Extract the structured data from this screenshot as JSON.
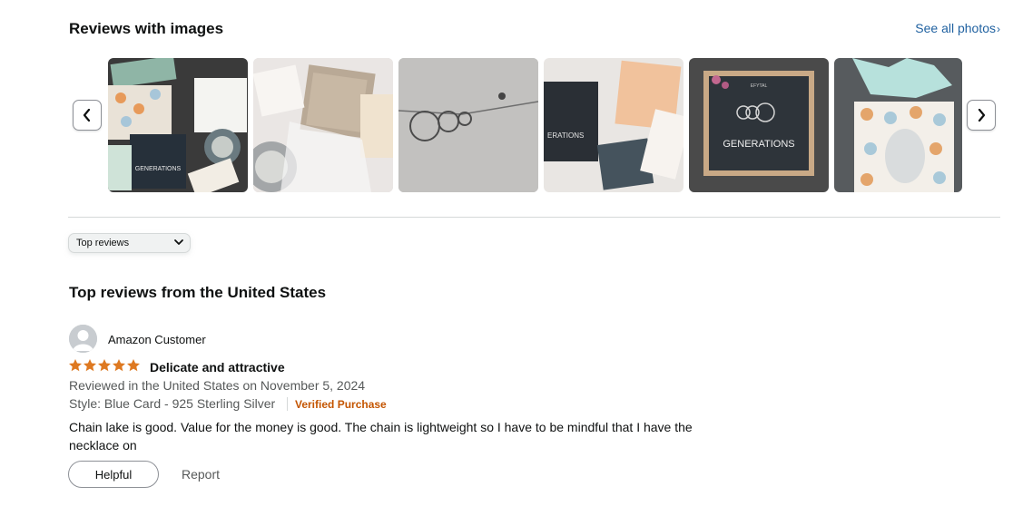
{
  "images_section": {
    "title": "Reviews with images",
    "see_all_label": "See all photos",
    "thumbnails": [
      {
        "name": "photo-1-gift-set",
        "overlay_text": "GENERATIONS"
      },
      {
        "name": "photo-2-packaging",
        "overlay_text": ""
      },
      {
        "name": "photo-3-necklace-closeup",
        "overlay_text": ""
      },
      {
        "name": "photo-4-card",
        "overlay_text": "ERATIONS"
      },
      {
        "name": "photo-5-card-display",
        "overlay_text": "GENERATIONS",
        "brand_text": "EFYTAL"
      },
      {
        "name": "photo-6-gift-bag",
        "overlay_text": ""
      }
    ],
    "icons": {
      "prev": "chevron-left-icon",
      "next": "chevron-right-icon"
    }
  },
  "sort": {
    "selected": "Top reviews"
  },
  "reviews_section": {
    "heading": "Top reviews from the United States",
    "reviews": [
      {
        "profile_name": "Amazon Customer",
        "rating": 5,
        "title": "Delicate and attractive",
        "date_line": "Reviewed in the United States on November 5, 2024",
        "style": "Style: Blue Card - 925 Sterling Silver",
        "verified": "Verified Purchase",
        "body": "Chain lake is good. Value for the money is good. The chain is lightweight so I have to be mindful that I have the necklace on",
        "helpful_label": "Helpful",
        "report_label": "Report"
      }
    ]
  },
  "colors": {
    "link": "#2162a1",
    "star": "#de7921",
    "verified": "#c45500",
    "muted": "#565959"
  }
}
